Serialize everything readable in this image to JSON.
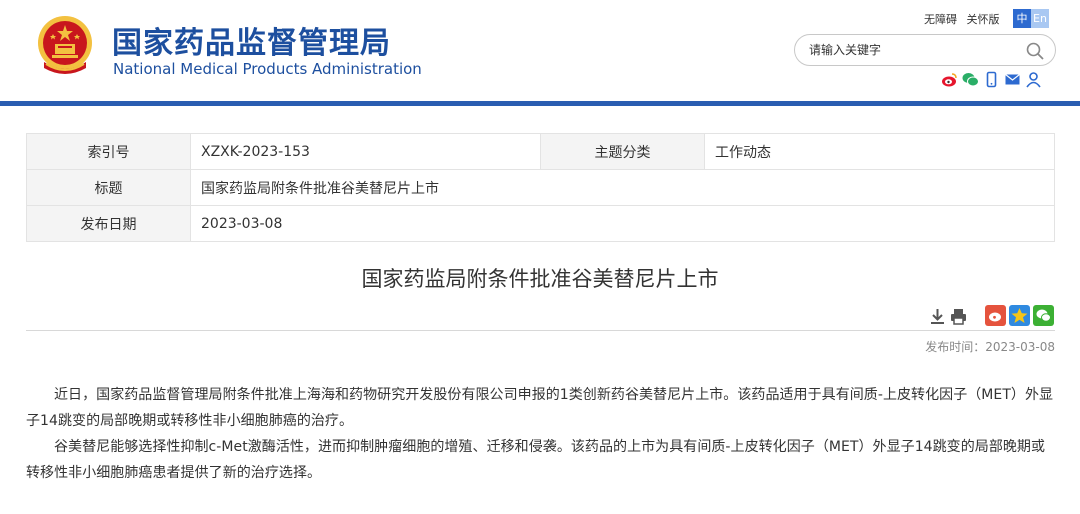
{
  "header": {
    "title_cn": "国家药品监督管理局",
    "title_en": "National Medical Products Administration",
    "links": [
      "无障碍",
      "关怀版"
    ],
    "lang": {
      "cn": "中",
      "en": "En"
    },
    "search_placeholder": "请输入关键字",
    "social_icons": [
      "weibo-icon",
      "wechat-icon",
      "mobile-icon",
      "mail-icon",
      "user-icon"
    ],
    "colors": {
      "brand": "#1d4f9f",
      "bar": "#2a5db1",
      "emblem_red": "#c8161d",
      "emblem_gold": "#f3c140"
    }
  },
  "info": {
    "index_label": "索引号",
    "index_value": "XZXK-2023-153",
    "category_label": "主题分类",
    "category_value": "工作动态",
    "title_label": "标题",
    "title_value": "国家药监局附条件批准谷美替尼片上市",
    "date_label": "发布日期",
    "date_value": "2023-03-08"
  },
  "article": {
    "title": "国家药监局附条件批准谷美替尼片上市",
    "tool_icons": [
      "download-icon",
      "print-icon"
    ],
    "share_icons": [
      "share-weibo-icon",
      "share-qzone-icon",
      "share-wechat-icon"
    ],
    "pub_time": "发布时间：2023-03-08",
    "paragraphs": [
      "近日，国家药品监督管理局附条件批准上海海和药物研究开发股份有限公司申报的1类创新药谷美替尼片上市。该药品适用于具有间质-上皮转化因子（MET）外显子14跳变的局部晚期或转移性非小细胞肺癌的治疗。",
      "谷美替尼能够选择性抑制c-Met激酶活性，进而抑制肿瘤细胞的增殖、迁移和侵袭。该药品的上市为具有间质-上皮转化因子（MET）外显子14跳变的局部晚期或转移性非小细胞肺癌患者提供了新的治疗选择。"
    ]
  }
}
